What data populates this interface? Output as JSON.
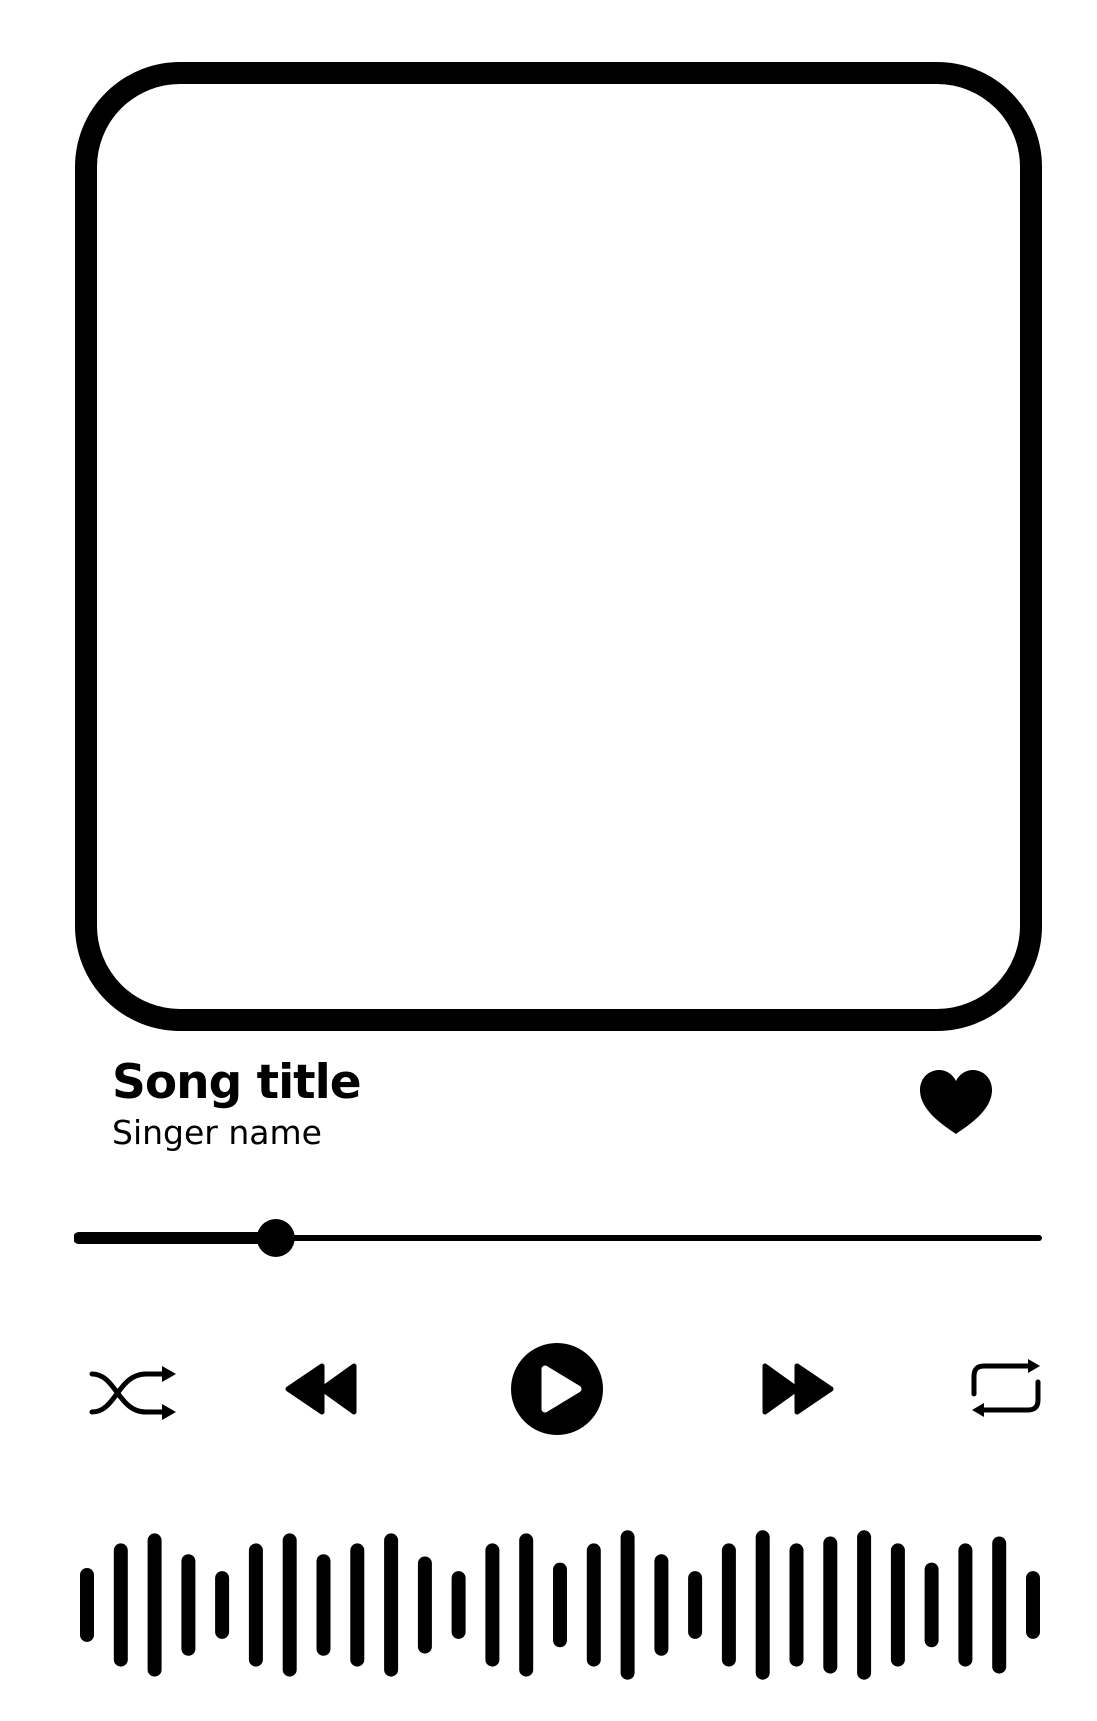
{
  "song": {
    "title": "Song title",
    "singer": "Singer name"
  },
  "playback": {
    "progress_fraction": 0.205
  },
  "controls": {
    "icons": [
      "shuffle-icon",
      "rewind-icon",
      "play-icon",
      "fast-forward-icon",
      "repeat-icon"
    ]
  },
  "waveform": {
    "bar_levels": [
      0.48,
      0.8,
      0.93,
      0.66,
      0.44,
      0.8,
      0.93,
      0.66,
      0.8,
      0.93,
      0.63,
      0.44,
      0.8,
      0.93,
      0.55,
      0.8,
      0.97,
      0.66,
      0.44,
      0.8,
      0.97,
      0.8,
      0.89,
      0.97,
      0.8,
      0.55,
      0.8,
      0.89,
      0.44
    ]
  },
  "colors": {
    "foreground": "#000000",
    "background": "#ffffff"
  }
}
